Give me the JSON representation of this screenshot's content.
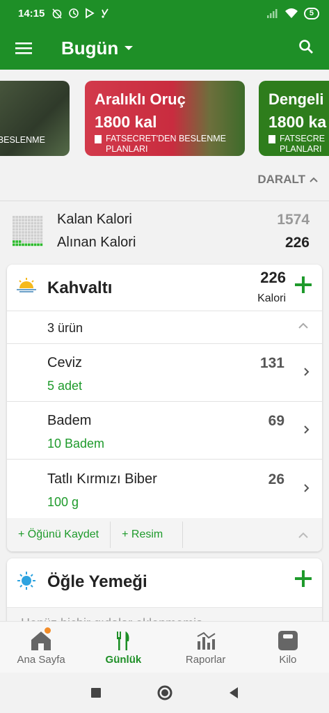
{
  "status": {
    "time": "14:15",
    "battery": "5"
  },
  "appbar": {
    "title": "Bugün"
  },
  "plans": [
    {
      "name": "",
      "kcal": "",
      "source_line1": "EN BESLENME",
      "source_line2": ""
    },
    {
      "name": "Aralıklı Oruç",
      "kcal": "1800 kal",
      "source_line1": "FATSECRET'DEN BESLENME",
      "source_line2": "PLANLARI"
    },
    {
      "name": "Dengeli",
      "kcal": "1800 ka",
      "source_line1": "FATSECRE",
      "source_line2": "PLANLARI"
    }
  ],
  "collapse_label": "DARALT",
  "summary": {
    "remaining_label": "Kalan Kalori",
    "remaining_value": "1574",
    "consumed_label": "Alınan Kalori",
    "consumed_value": "226"
  },
  "breakfast": {
    "title": "Kahvaltı",
    "calories": "226",
    "calories_unit": "Kalori",
    "item_count": "3 ürün",
    "items": [
      {
        "name": "Ceviz",
        "amount": "5  adet",
        "calories": "131"
      },
      {
        "name": "Badem",
        "amount": "10  Badem",
        "calories": "69"
      },
      {
        "name": "Tatlı Kırmızı Biber",
        "amount": "100  g",
        "calories": "26"
      }
    ],
    "actions": {
      "save_meal": "+ Öğünü Kaydet",
      "photo": "+ Resim"
    }
  },
  "lunch": {
    "title": "Öğle Yemeği",
    "empty_text": "Henüz hiçbir gıdalar eklenmemiş"
  },
  "bottomnav": {
    "home": "Ana Sayfa",
    "diary": "Günlük",
    "reports": "Raporlar",
    "weight": "Kilo"
  },
  "colors": {
    "brand_green": "#1e8f27",
    "accent_orange": "#f28c28",
    "plan_red": "#d23a4b"
  }
}
